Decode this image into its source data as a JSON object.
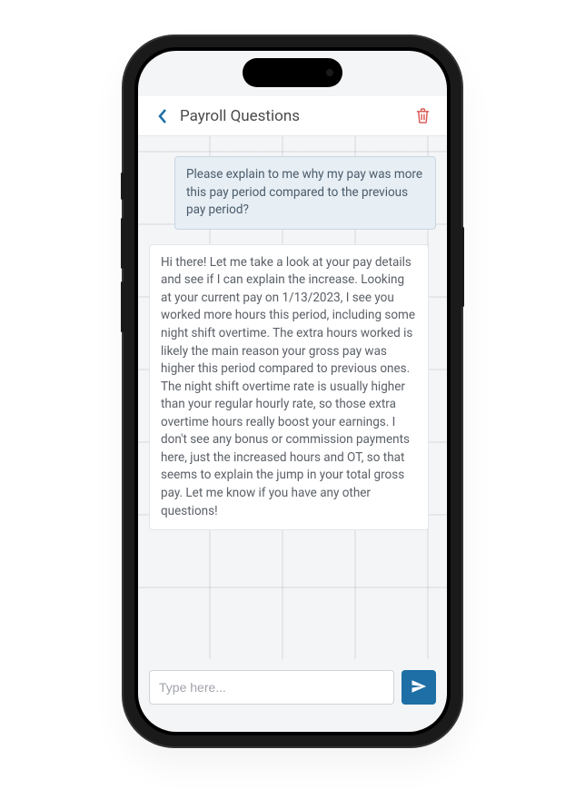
{
  "header": {
    "title": "Payroll Questions"
  },
  "messages": {
    "user": "Please explain to me why my pay was more this pay period compared to the previous pay period?",
    "assistant": "Hi there! Let me take a look at your pay details and see if I can explain the increase. Looking at your current pay on 1/13/2023, I see you worked more hours this period, including some night shift overtime. The extra hours worked is likely the main reason your gross pay was higher this period compared to previous ones. The night shift overtime rate is usually higher than your regular hourly rate, so those extra overtime hours really boost your earnings. I don't see any bonus or commission payments here, just the increased hours and OT, so that seems to explain the jump in your total gross pay. Let me know if you have any other questions!"
  },
  "composer": {
    "placeholder": "Type here..."
  }
}
